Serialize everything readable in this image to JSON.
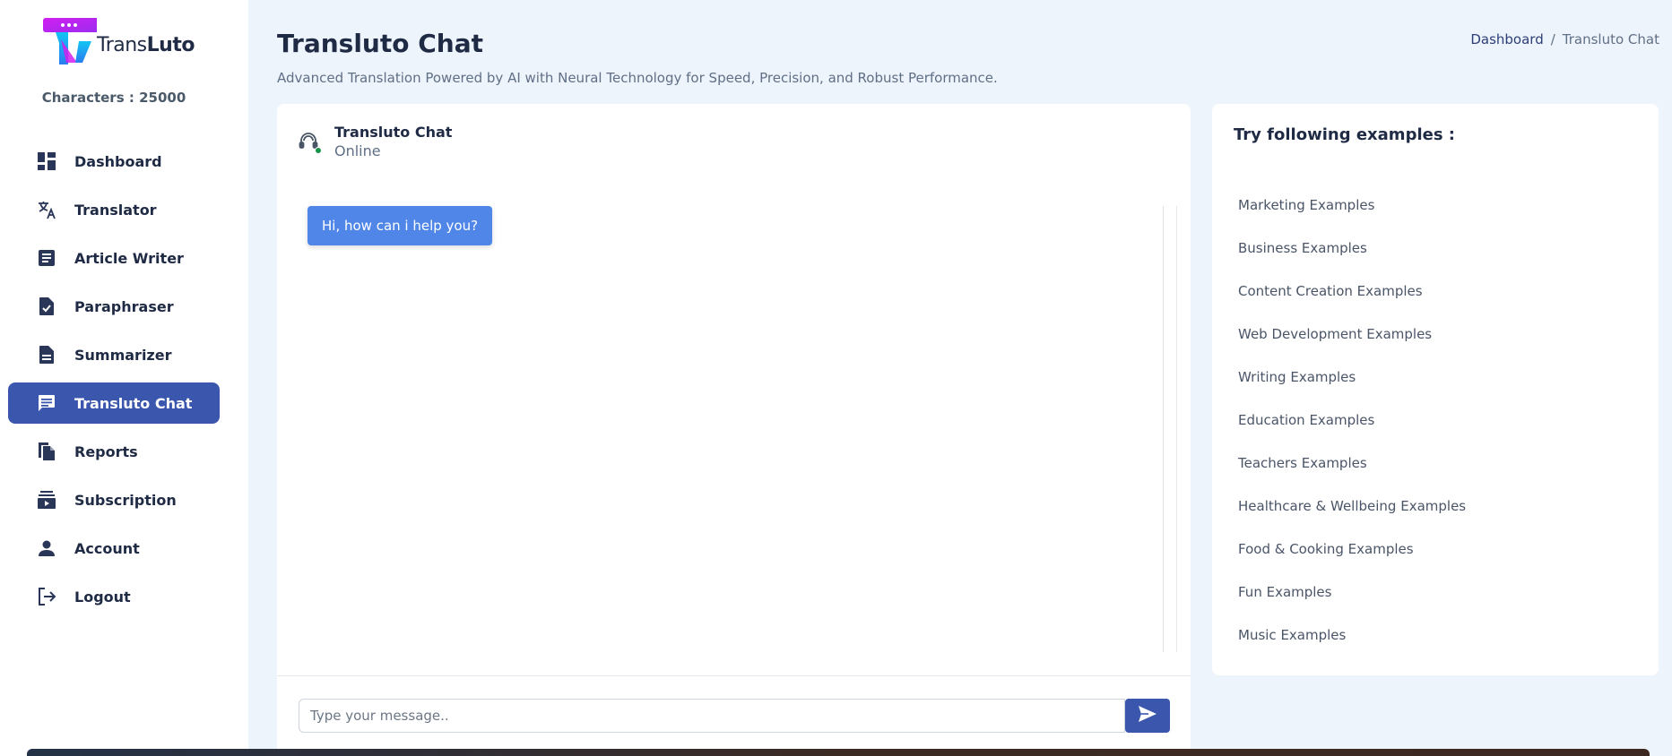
{
  "brand": {
    "name_light": "Trans",
    "name_bold": "Luto",
    "colors": {
      "accent": "#3a56ad",
      "logo_magenta": "#d11ff0",
      "logo_cyan": "#12c4f4"
    }
  },
  "sidebar": {
    "characters_label": "Characters : 25000",
    "items": [
      {
        "label": "Dashboard",
        "icon": "dashboard-icon",
        "active": false
      },
      {
        "label": "Translator",
        "icon": "translate-icon",
        "active": false
      },
      {
        "label": "Article Writer",
        "icon": "article-icon",
        "active": false
      },
      {
        "label": "Paraphraser",
        "icon": "file-check-icon",
        "active": false
      },
      {
        "label": "Summarizer",
        "icon": "document-icon",
        "active": false
      },
      {
        "label": "Transluto Chat",
        "icon": "chat-icon",
        "active": true
      },
      {
        "label": "Reports",
        "icon": "copy-icon",
        "active": false
      },
      {
        "label": "Subscription",
        "icon": "subscription-icon",
        "active": false
      },
      {
        "label": "Account",
        "icon": "person-icon",
        "active": false
      },
      {
        "label": "Logout",
        "icon": "logout-icon",
        "active": false
      }
    ]
  },
  "header": {
    "title": "Transluto Chat",
    "subtitle": "Advanced Translation Powered by AI with Neural Technology for Speed, Precision, and Robust Performance.",
    "breadcrumb": {
      "home": "Dashboard",
      "separator": "/",
      "current": "Transluto Chat"
    }
  },
  "chat": {
    "name": "Transluto Chat",
    "status": "Online",
    "messages": [
      {
        "from": "bot",
        "text": "Hi, how can i help you?"
      }
    ],
    "input_placeholder": "Type your message..",
    "input_value": ""
  },
  "examples": {
    "title": "Try following examples :",
    "items": [
      "Marketing Examples",
      "Business Examples",
      "Content Creation Examples",
      "Web Development Examples",
      "Writing Examples",
      "Education Examples",
      "Teachers Examples",
      "Healthcare & Wellbeing Examples",
      "Food & Cooking Examples",
      "Fun Examples",
      "Music Examples"
    ]
  }
}
